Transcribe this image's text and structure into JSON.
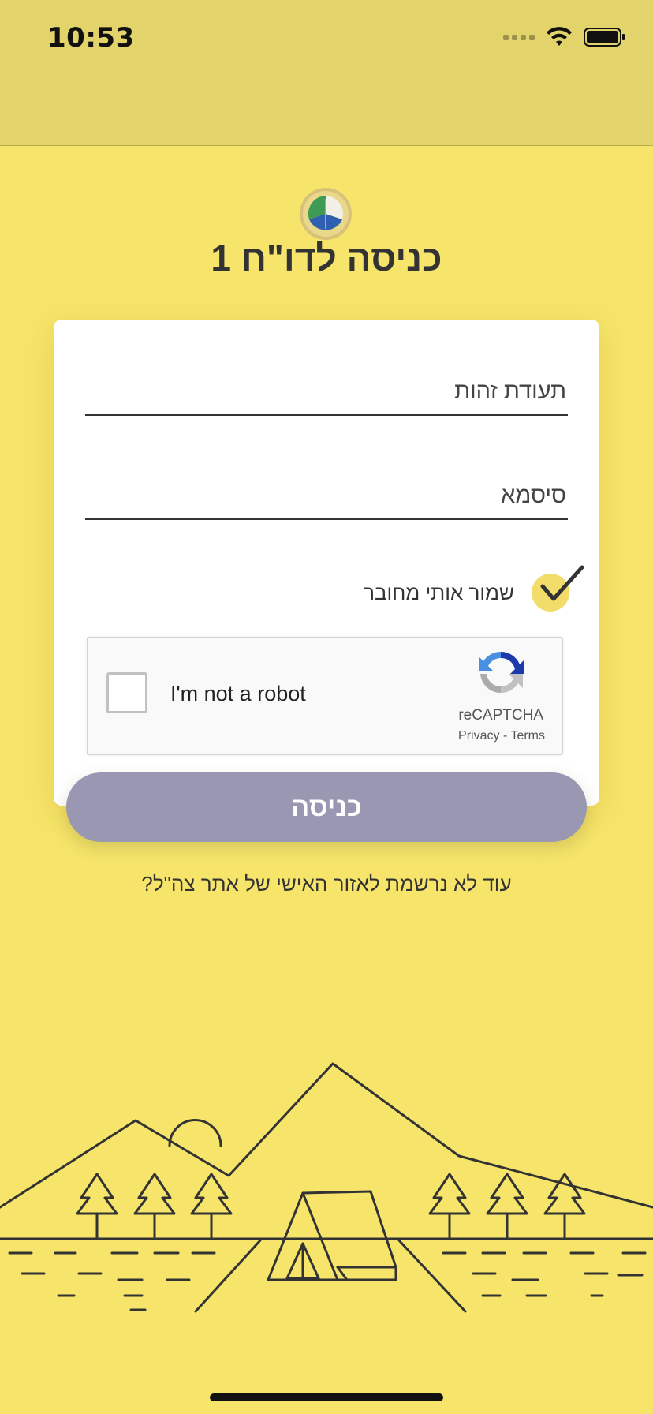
{
  "status_bar": {
    "time": "10:53"
  },
  "header": {
    "title": "כניסה לדו\"ח 1"
  },
  "form": {
    "id_placeholder": "תעודת זהות",
    "password_placeholder": "סיסמא",
    "remember_label": "שמור אותי מחובר",
    "remember_checked": true
  },
  "captcha": {
    "label": "I'm not a robot",
    "brand": "reCAPTCHA",
    "privacy": "Privacy",
    "separator": "-",
    "terms": "Terms"
  },
  "login_button": {
    "label": "כניסה"
  },
  "register_link": {
    "text": "עוד לא נרשמת לאזור האישי של אתר צה\"ל?"
  },
  "colors": {
    "background": "#f6e56a",
    "status_bar": "#e2d46a",
    "button": "#9a97b3",
    "check": "#f2dd6a"
  }
}
